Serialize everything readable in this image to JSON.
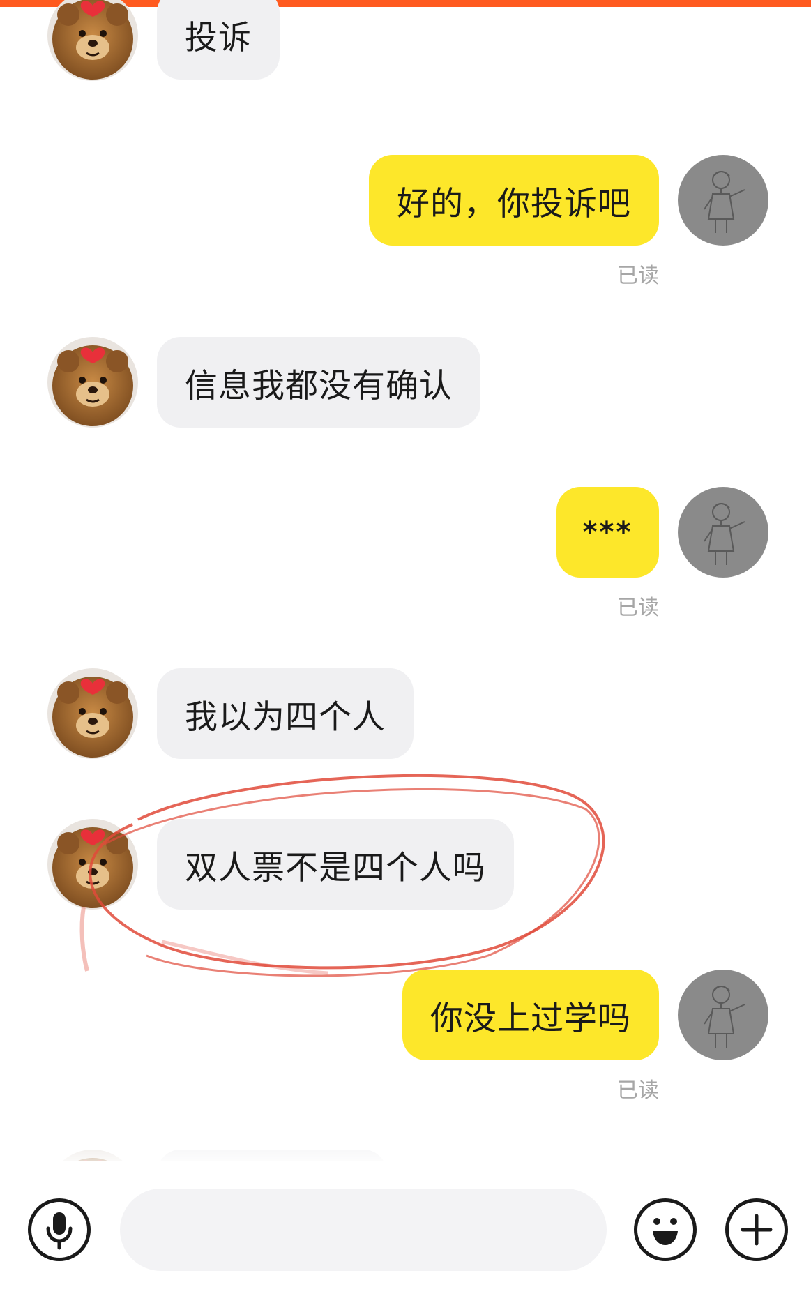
{
  "colors": {
    "top_bar": "#ff5a1f",
    "incoming_bubble": "#f0f0f2",
    "outgoing_bubble": "#fde72a",
    "annotation": "#e04a3a"
  },
  "messages": [
    {
      "side": "in",
      "text": "投诉"
    },
    {
      "side": "out",
      "text": "好的，你投诉吧",
      "status": "已读"
    },
    {
      "side": "in",
      "text": "信息我都没有确认"
    },
    {
      "side": "out",
      "text": "***",
      "status": "已读"
    },
    {
      "side": "in",
      "text": "我以为四个人"
    },
    {
      "side": "in",
      "text": "双人票不是四个人吗"
    },
    {
      "side": "out",
      "text": "你没上过学吗",
      "status": "已读"
    }
  ],
  "composer": {
    "placeholder": "",
    "voice_icon": "microphone-icon",
    "emoji_icon": "emoji-icon",
    "plus_icon": "plus-icon"
  }
}
